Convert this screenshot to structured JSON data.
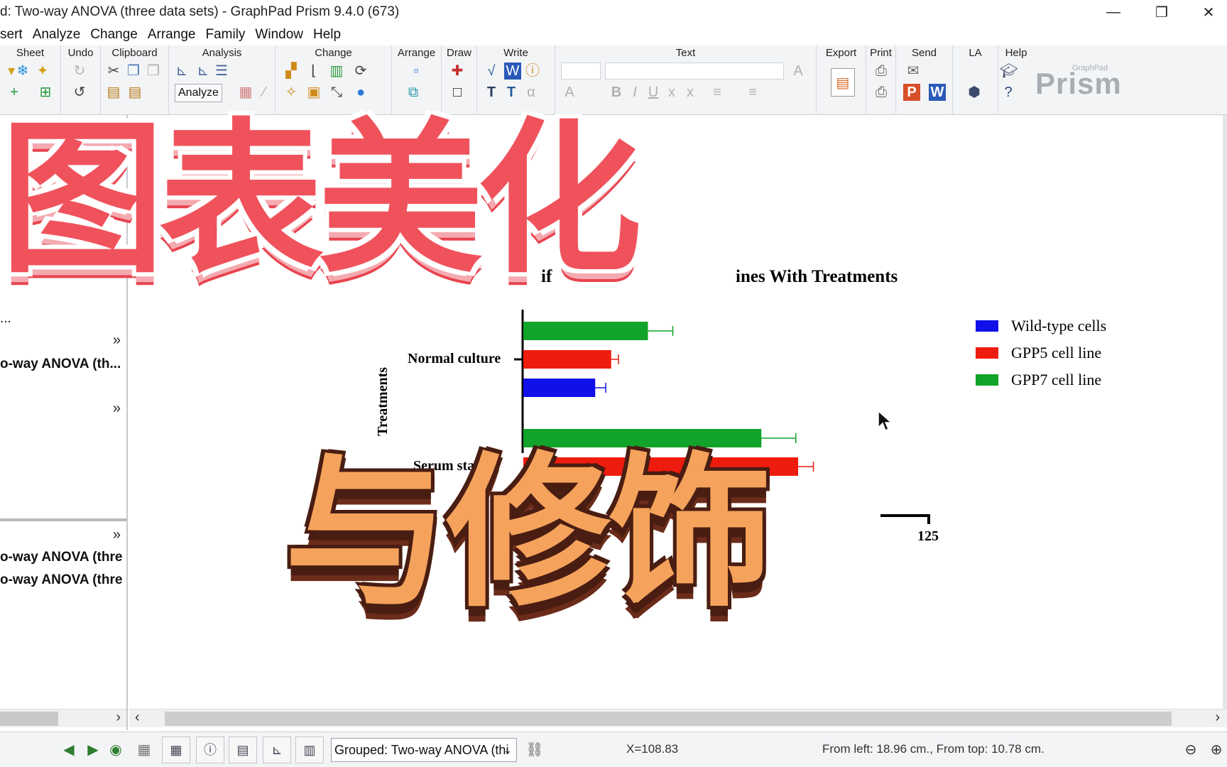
{
  "window": {
    "title": "d: Two-way ANOVA (three data sets) - GraphPad Prism 9.4.0 (673)",
    "minimize": "—",
    "restore": "❐",
    "close": "✕"
  },
  "menu": [
    "sert",
    "Analyze",
    "Change",
    "Arrange",
    "Family",
    "Window",
    "Help"
  ],
  "ribbon": {
    "groups": {
      "sheet": "Sheet",
      "undo": "Undo",
      "clipboard": "Clipboard",
      "analysis": "Analysis",
      "change": "Change",
      "arrange": "Arrange",
      "draw": "Draw",
      "write": "Write",
      "text": "Text",
      "export": "Export",
      "print": "Print",
      "send": "Send",
      "la": "LA",
      "help": "Help"
    },
    "analyze_button": "Analyze",
    "logo": "Prism",
    "logo_small": "GraphPad"
  },
  "navigator": {
    "item_dots": "...",
    "section1": "o-way ANOVA (th...",
    "section2_a": "o-way ANOVA (thre",
    "section2_b": "o-way ANOVA (thre",
    "chevron": "»"
  },
  "overlay": {
    "headline_top": "图表美化",
    "headline_bottom": "与修饰"
  },
  "chart_data": {
    "type": "bar",
    "orientation": "horizontal",
    "title_fragment_left": "if",
    "title_fragment_right": "ines With Treatments",
    "ylabel": "Treatments",
    "categories": [
      "Normal culture",
      "Serum starve"
    ],
    "tick_label_visible": "125",
    "series": [
      {
        "name": "Wild-type cells",
        "color": "#1010e8",
        "values": [
          45,
          null
        ],
        "errors": [
          7,
          null
        ]
      },
      {
        "name": "GPP5 cell line",
        "color": "#ee1c0e",
        "values": [
          55,
          172
        ],
        "errors": [
          5,
          10
        ]
      },
      {
        "name": "GPP7 cell line",
        "color": "#11a32a",
        "values": [
          78,
          149
        ],
        "errors": [
          16,
          22
        ]
      }
    ],
    "xlim": [
      0,
      230
    ],
    "legend_position": "right"
  },
  "statusbar": {
    "sheet_select": "Grouped: Two-way ANOVA (thi",
    "coord_x": "X=108.83",
    "position": "From left: 18.96 cm., From top: 10.78 cm."
  }
}
